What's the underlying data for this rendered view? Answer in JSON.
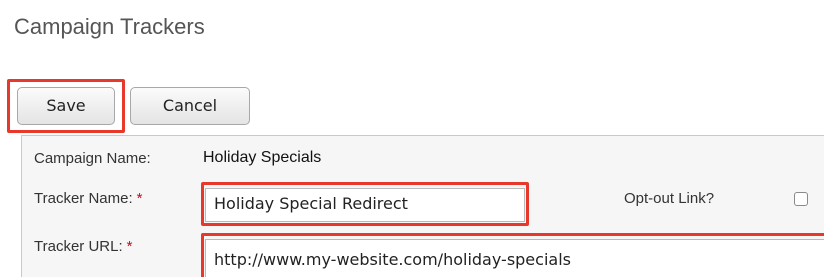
{
  "page": {
    "title": "Campaign Trackers"
  },
  "toolbar": {
    "save_label": "Save",
    "cancel_label": "Cancel"
  },
  "form": {
    "campaign_name": {
      "label": "Campaign Name:",
      "value": "Holiday Specials"
    },
    "tracker_name": {
      "label": "Tracker Name:",
      "required_mark": "*",
      "value": "Holiday Special Redirect"
    },
    "opt_out": {
      "label": "Opt-out Link?",
      "checked": false
    },
    "tracker_url": {
      "label": "Tracker URL:",
      "required_mark": "*",
      "value": "http://www.my-website.com/holiday-specials"
    }
  },
  "colors": {
    "highlight": "#e8382b",
    "required": "#d0021b",
    "panel_bg": "#f6f6f6"
  }
}
